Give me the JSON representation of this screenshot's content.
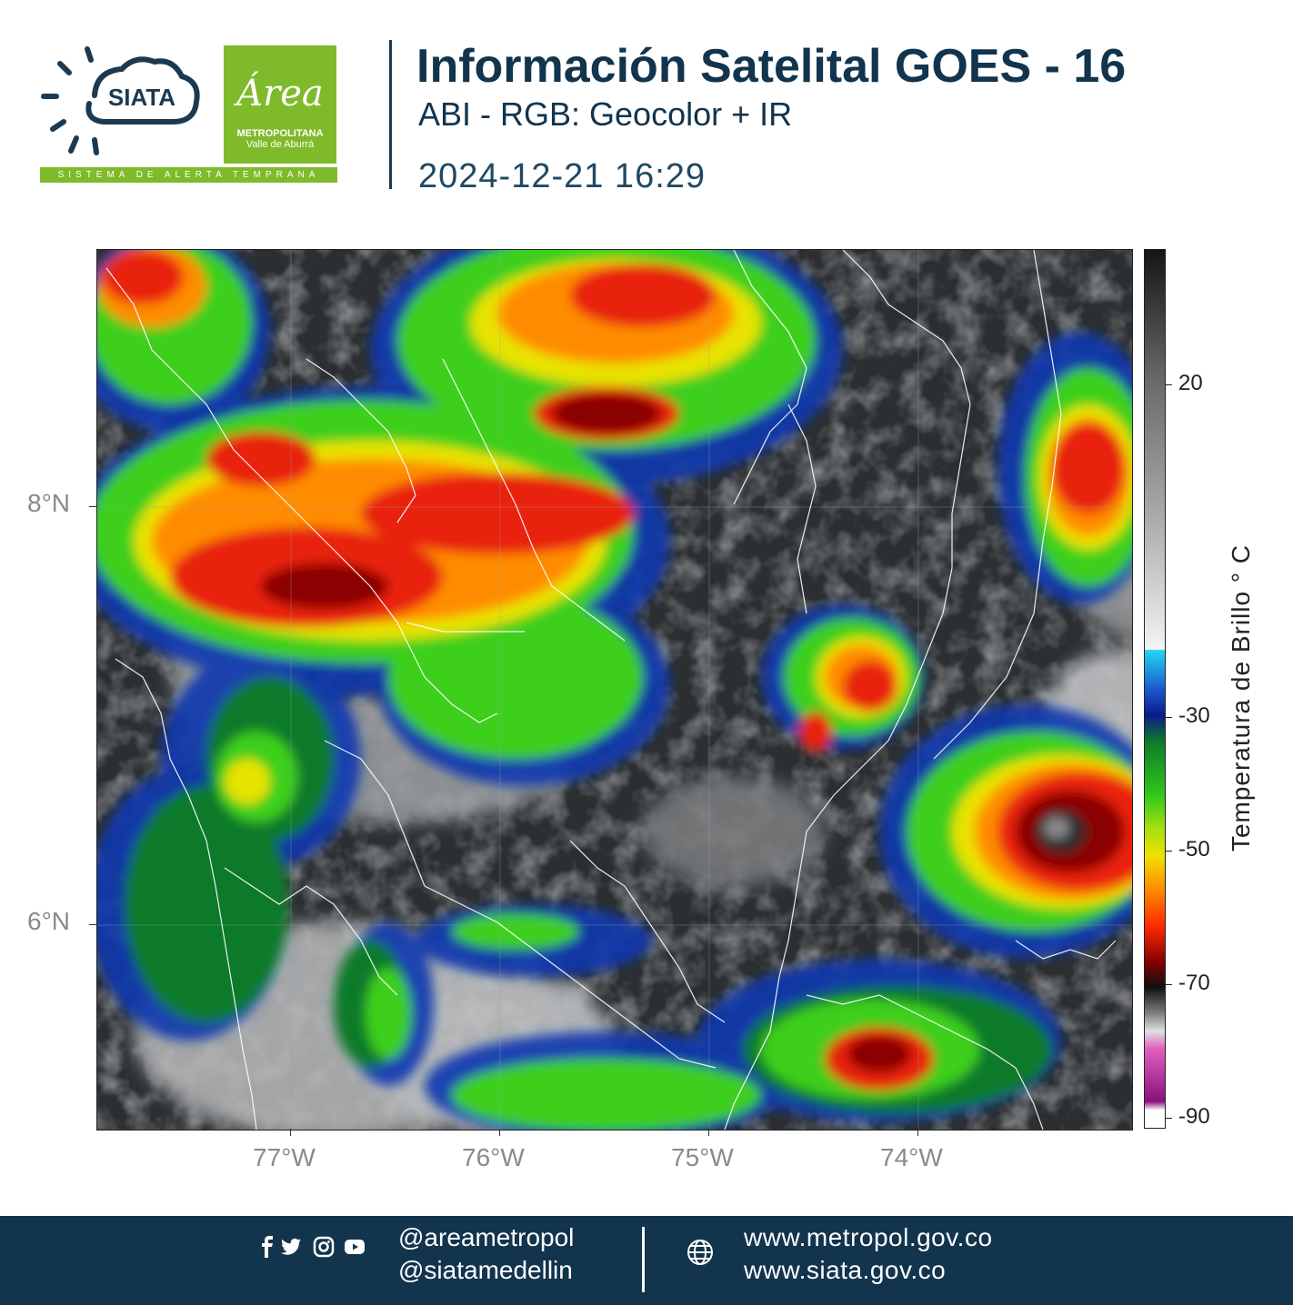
{
  "header": {
    "siata_logo_text": "SIATA",
    "area_logo_word": "Área",
    "area_logo_line1": "METROPOLITANA",
    "area_logo_line2": "Valle de Aburrá",
    "alert_strip": "SISTEMA DE ALERTA TEMPRANA",
    "title": "Información Satelital GOES - 16",
    "subtitle": "ABI - RGB: Geocolor + IR",
    "timestamp": "2024-12-21 16:29"
  },
  "map": {
    "lat_labels": [
      "8°N",
      "6°N"
    ],
    "lon_labels": [
      "77°W",
      "76°W",
      "75°W",
      "74°W"
    ],
    "gridlines": true,
    "colors": {
      "cold_top": "#8b0000",
      "red": "#e8200c",
      "orange": "#ff8c00",
      "yellow": "#e8e200",
      "green": "#3ecf1c",
      "dark_green": "#0f7a2a",
      "blue": "#1038b0",
      "cyan": "#18c8e8",
      "cloud_grey": "#8c8f92",
      "dark_bg": "#2c2f31",
      "border_lines": "#ffffff"
    }
  },
  "colorbar": {
    "title": "Temperatura de Brillo  ° C",
    "tick_labels": [
      "20",
      "-30",
      "-50",
      "-70",
      "-90"
    ],
    "tick_values": [
      20,
      -30,
      -50,
      -70,
      -90
    ],
    "range": [
      30,
      -90
    ]
  },
  "footer": {
    "handles": [
      "@areametropol",
      "@siatamedellin"
    ],
    "websites": [
      "www.metropol.gov.co",
      "www.siata.gov.co"
    ],
    "icons": [
      "facebook-icon",
      "twitter-icon",
      "instagram-icon",
      "youtube-icon",
      "globe-icon"
    ]
  }
}
